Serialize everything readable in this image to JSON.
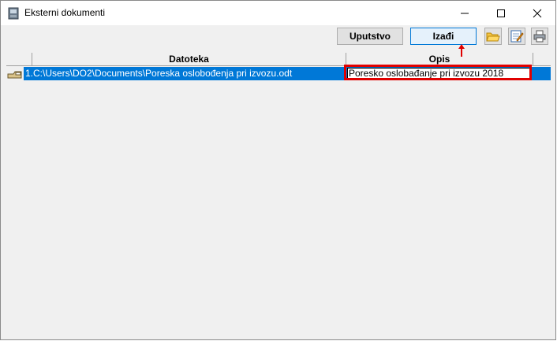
{
  "window": {
    "title": "Eksterni dokumenti"
  },
  "toolbar": {
    "help_label": "Uputstvo",
    "exit_label": "Izađi"
  },
  "grid": {
    "columns": [
      "Datoteka",
      "Opis"
    ],
    "rows": [
      {
        "num": "1.",
        "file": "C:\\Users\\DO2\\Documents\\Poreska oslobođenja pri izvozu.odt",
        "desc": "Poresko oslobađanje pri izvozu 2018"
      }
    ]
  },
  "colors": {
    "selection": "#0078d7",
    "annotation": "#e00000"
  },
  "icons": [
    "app-icon",
    "minimize-icon",
    "maximize-icon",
    "close-icon",
    "folder-open-icon",
    "edit-icon",
    "print-icon",
    "row-indicator-icon",
    "arrow-up-icon"
  ]
}
